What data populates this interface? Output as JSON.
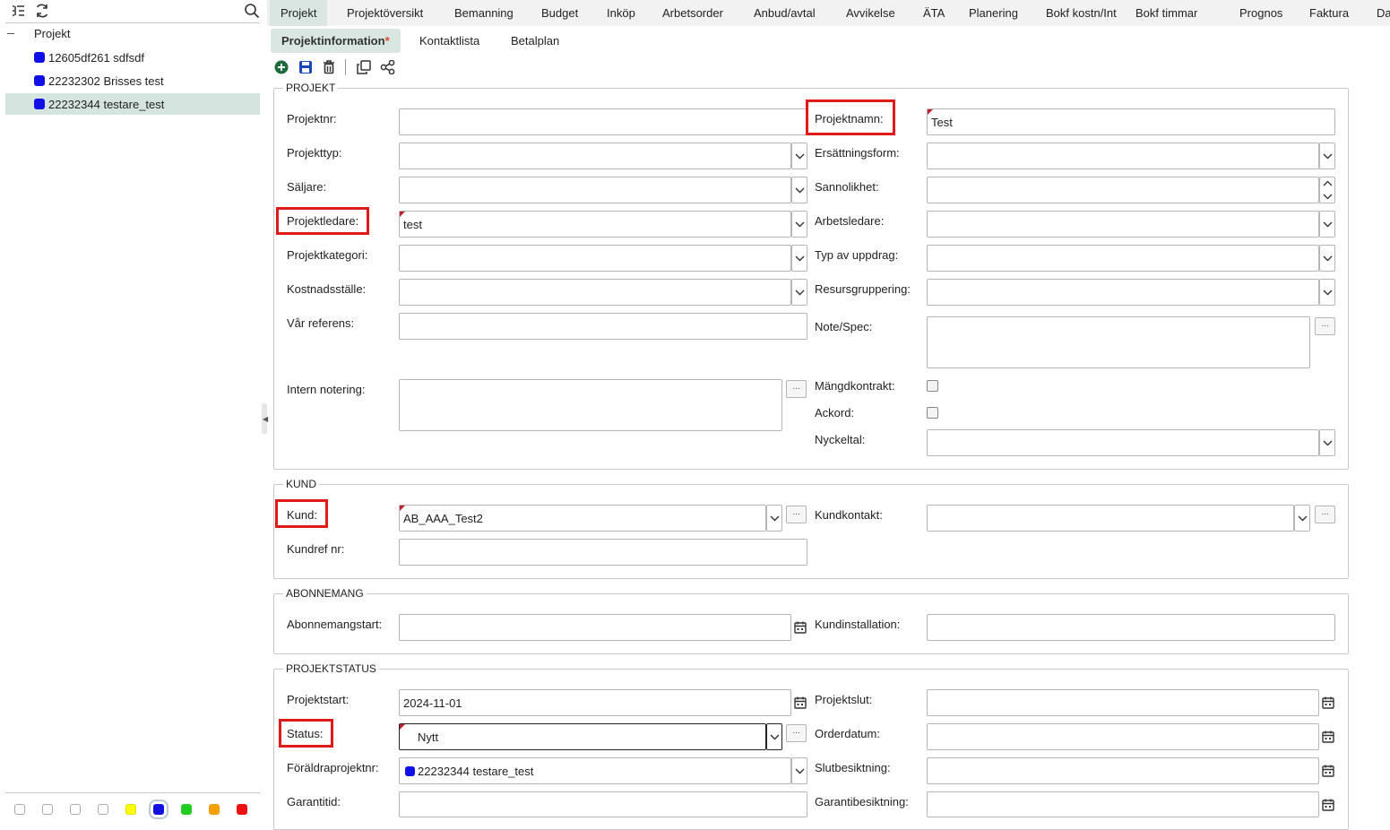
{
  "tree": {
    "root_label": "Projekt",
    "items": [
      {
        "label": "12605df261 sdfsdf",
        "color": "#1010e6"
      },
      {
        "label": "22232302 Brisses test",
        "color": "#1010e6"
      },
      {
        "label": "22232344 testare_test",
        "color": "#1010e6",
        "selected": true
      }
    ]
  },
  "color_filter": [
    "#ffffff",
    "#ffffff",
    "#ffffff",
    "#ffffff",
    "#ffff00",
    "#1010e6",
    "#22cc22",
    "#f5a000",
    "#ee1111"
  ],
  "tabs": [
    "Projekt",
    "Projektöversikt",
    "Bemanning",
    "Budget",
    "Inköp",
    "Arbetsorder",
    "Anbud/avtal",
    "Avvikelse",
    "ÄTA",
    "Planering",
    "Bokf kostn/Int",
    "Bokf timmar",
    "Prognos",
    "Faktura",
    "Da"
  ],
  "subtabs": {
    "info": "Projektinformation",
    "info_star": "*",
    "contacts": "Kontaktlista",
    "payplan": "Betalplan"
  },
  "projekt": {
    "legend": "PROJEKT",
    "projektnr": "Projektnr:",
    "projektnamn": "Projektnamn:",
    "projektnamn_value": "Test",
    "projekttyp": "Projekttyp:",
    "ersattningsform": "Ersättningsform:",
    "saljare": "Säljare:",
    "sannolikhet": "Sannolikhet:",
    "projektledare": "Projektledare:",
    "projektledare_value": "test",
    "arbetsledare": "Arbetsledare:",
    "projektkategori": "Projektkategori:",
    "typ_av_uppdrag": "Typ av uppdrag:",
    "kostnadsstalle": "Kostnadsställe:",
    "resursgruppering": "Resursgruppering:",
    "var_referens": "Vår referens:",
    "note_spec": "Note/Spec:",
    "intern_notering": "Intern notering:",
    "mangdkontrakt": "Mängdkontrakt:",
    "ackord": "Ackord:",
    "nyckeltal": "Nyckeltal:"
  },
  "kund": {
    "legend": "KUND",
    "kund": "Kund:",
    "kund_value": "AB_AAA_Test2",
    "kundkontakt": "Kundkontakt:",
    "kundref": "Kundref nr:"
  },
  "abonnemang": {
    "legend": "ABONNEMANG",
    "abonnemangstart": "Abonnemangstart:",
    "kundinstallation": "Kundinstallation:"
  },
  "projektstatus": {
    "legend": "PROJEKTSTATUS",
    "projektstart": "Projektstart:",
    "projektstart_value": "2024-11-01",
    "projektslut": "Projektslut:",
    "status": "Status:",
    "status_value": "Nytt",
    "orderdatum": "Orderdatum:",
    "foraldraprojektnr": "Föräldraprojektnr:",
    "foraldraprojektnr_value": "22232344 testare_test",
    "slutbesiktning": "Slutbesiktning:",
    "garantitid": "Garantitid:",
    "garantibesiktning": "Garantibesiktning:"
  },
  "dots_label": "...",
  "colors": {
    "accent_tab": "#d9e6e2",
    "highlight": "#e01919",
    "required_marker": "#c0202a"
  }
}
